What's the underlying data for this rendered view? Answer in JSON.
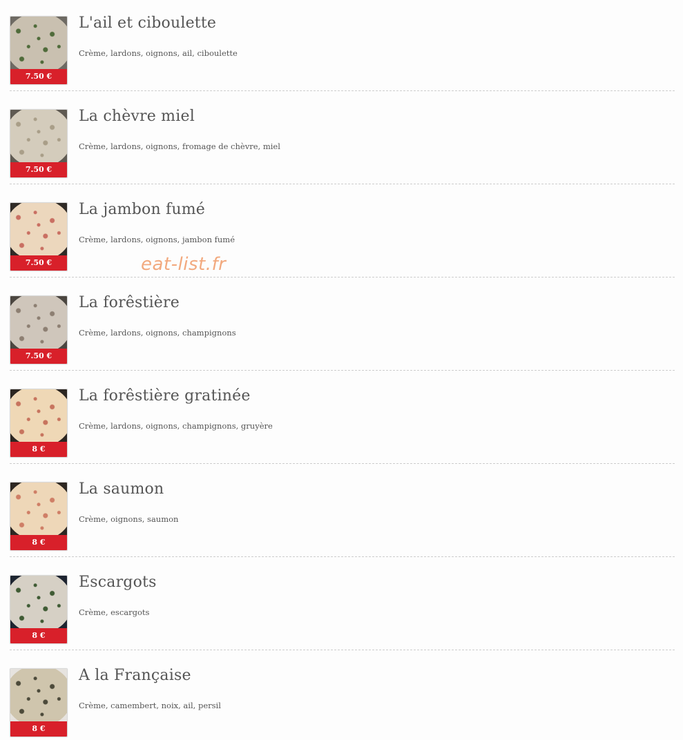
{
  "watermark": "eat-list.fr",
  "items": [
    {
      "title": "L'ail et ciboulette",
      "description": "Crème, lardons, oignons, ail, ciboulette",
      "price": "7.50 €",
      "image": "pizza-garlic-chive-photo",
      "tint": "#c9c0b0",
      "topping": "#4f6b3a",
      "bg": "#6e6a63"
    },
    {
      "title": "La chèvre miel",
      "description": "Crème, lardons, oignons, fromage de chèvre, miel",
      "price": "7.50 €",
      "image": "pizza-goat-cheese-honey-photo",
      "tint": "#d4ccbc",
      "topping": "#a99e88",
      "bg": "#5f5a52"
    },
    {
      "title": "La jambon fumé",
      "description": "Crème, lardons, oignons, jambon fumé",
      "price": "7.50 €",
      "image": "pizza-smoked-ham-photo",
      "tint": "#ecd7bd",
      "topping": "#c96f62",
      "bg": "#2f2a26"
    },
    {
      "title": "La forêstière",
      "description": "Crème, lardons, oignons, champignons",
      "price": "7.50 €",
      "image": "pizza-mushroom-photo",
      "tint": "#cfc6bb",
      "topping": "#8d7f72",
      "bg": "#4b4640"
    },
    {
      "title": "La forêstière gratinée",
      "description": "Crème, lardons, oignons, champignons, gruyère",
      "price": "8 €",
      "image": "pizza-mushroom-gratin-photo",
      "tint": "#efd8b6",
      "topping": "#c7745e",
      "bg": "#2c2621"
    },
    {
      "title": "La saumon",
      "description": "Crème, oignons, saumon",
      "price": "8 €",
      "image": "pizza-salmon-photo",
      "tint": "#eed7b8",
      "topping": "#cf7e66",
      "bg": "#2d2722"
    },
    {
      "title": "Escargots",
      "description": "Crème, escargots",
      "price": "8 €",
      "image": "pizza-snails-photo",
      "tint": "#d6d0c5",
      "topping": "#3f5b34",
      "bg": "#1d2430"
    },
    {
      "title": "A la Française",
      "description": "Crème, camembert, noix, ail, persil",
      "price": "8 €",
      "image": "pizza-french-camembert-photo",
      "tint": "#cfc5ad",
      "topping": "#4c4a3a",
      "bg": "#e6e3df"
    }
  ]
}
